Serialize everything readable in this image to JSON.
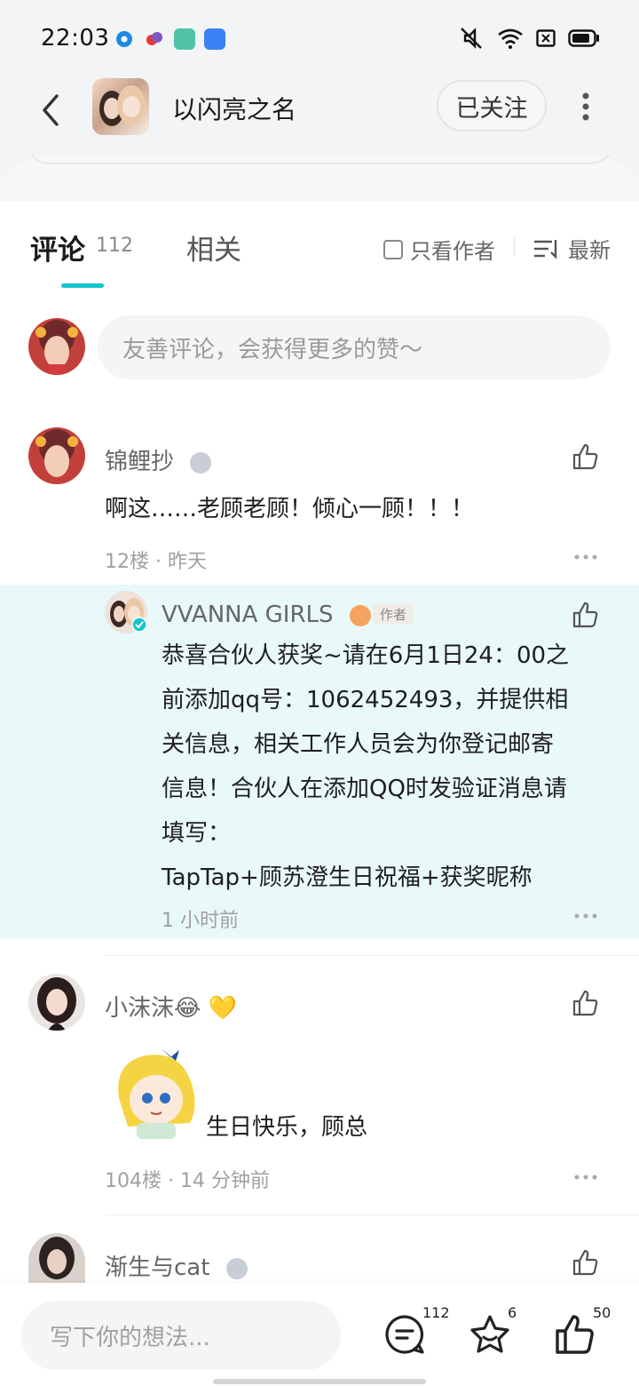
{
  "status_bar": {
    "time": "22:03"
  },
  "header": {
    "back_label": "back",
    "title": "以闪亮之名",
    "follow_label": "已关注"
  },
  "tabs": {
    "comments_label": "评论",
    "comments_count": "112",
    "related_label": "相关",
    "only_author_label": "只看作者",
    "sort_label": "最新"
  },
  "composer": {
    "placeholder": "友善评论，会获得更多的赞～"
  },
  "comments": [
    {
      "name": "锦鲤抄",
      "text": "啊这……老顾老顾！倾心一顾！！！",
      "meta": "12楼 · 昨天"
    },
    {
      "name": "小沫沫😂 💛",
      "text": "生日快乐，顾总",
      "meta": "104楼 · 14 分钟前"
    },
    {
      "name": "渐生与cat"
    }
  ],
  "reply": {
    "name": "VVANNA GIRLS",
    "author_tag": "作者",
    "lines": [
      "恭喜合伙人获奖~请在6月1日24：00之",
      "前添加qq号：1062452493，并提供相",
      "关信息，相关工作人员会为你登记邮寄",
      "信息！合伙人在添加QQ时发验证消息请",
      "填写：",
      "TapTap+顾苏澄生日祝福+获奖昵称"
    ],
    "meta": "1 小时前"
  },
  "bottom_bar": {
    "write_placeholder": "写下你的想法...",
    "comment_count": "112",
    "favorite_count": "6",
    "like_count": "50"
  },
  "colors": {
    "accent": "#15c5ce",
    "reply_bg": "#e9f8f8",
    "header_bg": "#f2f4f6"
  },
  "icons": [
    "back-icon",
    "more-vertical-icon",
    "sort-icon",
    "thumb-up-icon",
    "more-dots-icon",
    "comment-icon",
    "star-icon"
  ]
}
